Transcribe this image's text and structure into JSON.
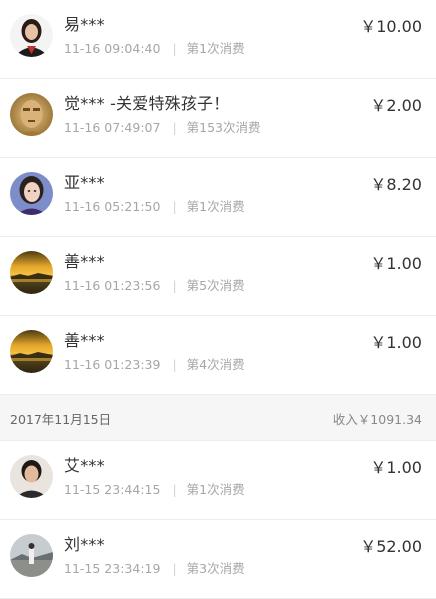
{
  "transactions_a": [
    {
      "name": "易***",
      "time": "11-16 09:04:40",
      "count": "第1次消费",
      "amount": "￥10.00",
      "avatar": "woman-dark-hair-portrait"
    },
    {
      "name": "觉*** -关爱特殊孩子！",
      "time": "11-16 07:49:07",
      "count": "第153次消费",
      "amount": "￥2.00",
      "avatar": "buddha-statue-portrait"
    },
    {
      "name": "亚***",
      "time": "11-16 05:21:50",
      "count": "第1次消费",
      "amount": "￥8.20",
      "avatar": "woman-selfie-portrait"
    },
    {
      "name": "善***",
      "time": "11-16 01:23:56",
      "count": "第5次消费",
      "amount": "￥1.00",
      "avatar": "sunset-landscape"
    },
    {
      "name": "善***",
      "time": "11-16 01:23:39",
      "count": "第4次消费",
      "amount": "￥1.00",
      "avatar": "sunset-landscape"
    }
  ],
  "day_header": {
    "date": "2017年11月15日",
    "income": "收入￥1091.34"
  },
  "transactions_b": [
    {
      "name": "艾***",
      "time": "11-15 23:44:15",
      "count": "第1次消费",
      "amount": "￥1.00",
      "avatar": "woman-portrait"
    },
    {
      "name": "刘***",
      "time": "11-15 23:34:19",
      "count": "第3次消费",
      "amount": "￥52.00",
      "avatar": "person-outdoor-photo"
    }
  ],
  "separator": "|",
  "colors": {
    "text": "#333333",
    "meta": "#a6a6a6",
    "divider": "#ececec",
    "header_bg": "#f6f6f6"
  }
}
